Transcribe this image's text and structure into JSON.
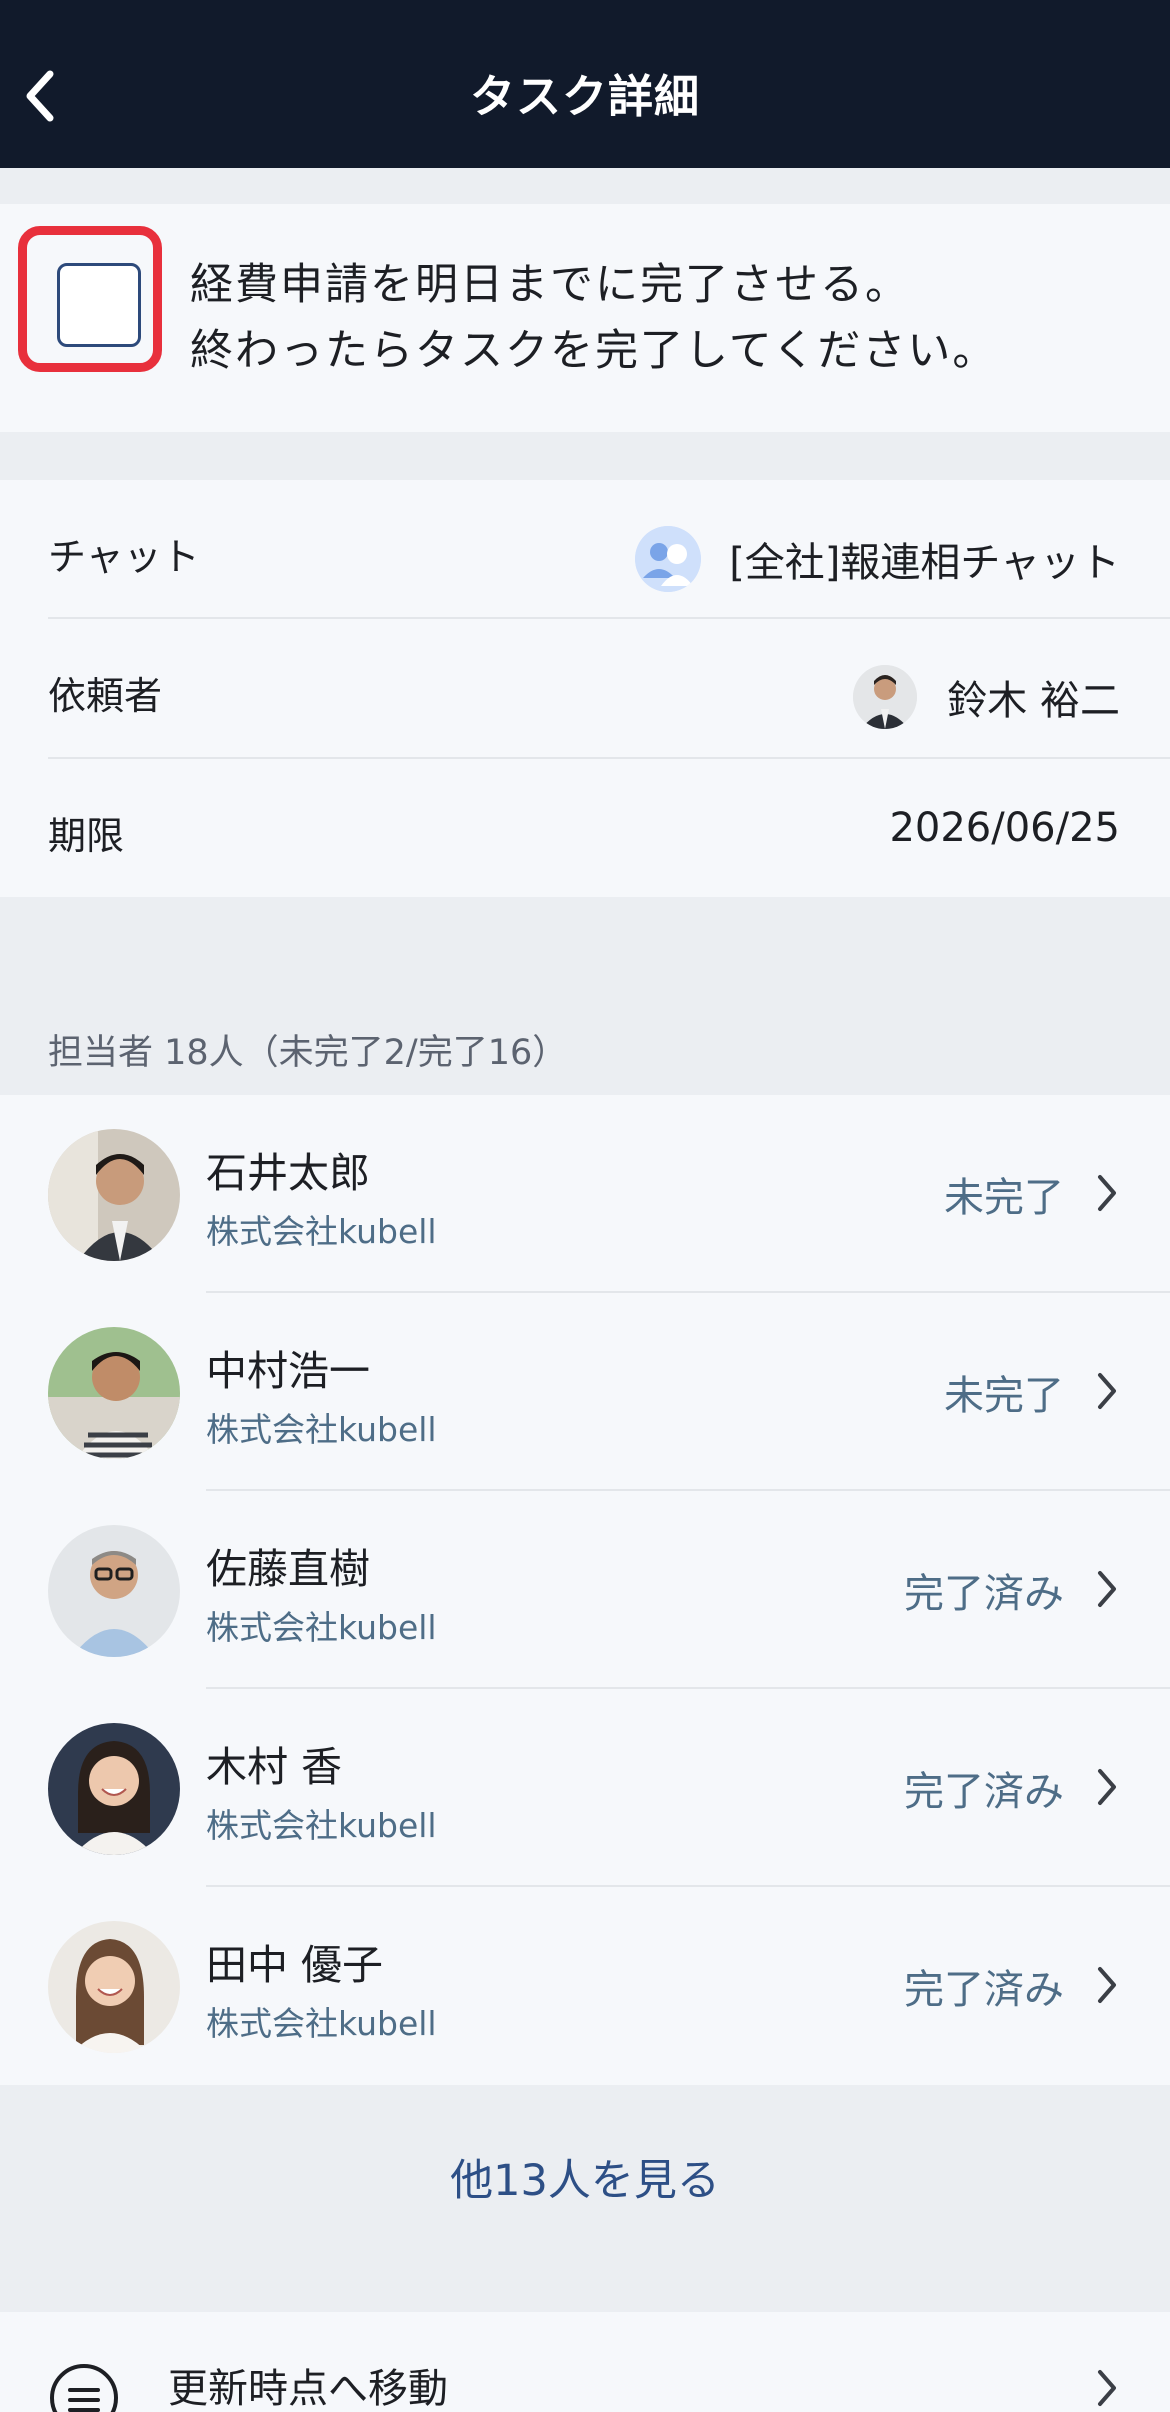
{
  "header": {
    "title": "タスク詳細"
  },
  "task": {
    "line1": "経費申請を明日までに完了させる。",
    "line2": "終わったらタスクを完了してください。"
  },
  "info": {
    "chat_label": "チャット",
    "chat_value": "[全社]報連相チャット",
    "requester_label": "依頼者",
    "requester_value": "鈴木 裕二",
    "deadline_label": "期限",
    "deadline_value": "2026/06/25"
  },
  "assignees": {
    "section_label": "担当者 18人（未完了2/完了16）",
    "members": [
      {
        "name": "石井太郎",
        "company": "株式会社kubell",
        "status": "未完了"
      },
      {
        "name": "中村浩一",
        "company": "株式会社kubell",
        "status": "未完了"
      },
      {
        "name": "佐藤直樹",
        "company": "株式会社kubell",
        "status": "完了済み"
      },
      {
        "name": "木村 香",
        "company": "株式会社kubell",
        "status": "完了済み"
      },
      {
        "name": "田中 優子",
        "company": "株式会社kubell",
        "status": "完了済み"
      }
    ],
    "see_more": "他13人を見る"
  },
  "bottom": {
    "label": "更新時点へ移動"
  },
  "colors": {
    "header_bg": "#111a2b",
    "checkbox_highlight": "#e8303c",
    "status_text": "#4e6d87",
    "link": "#2d4f86"
  }
}
